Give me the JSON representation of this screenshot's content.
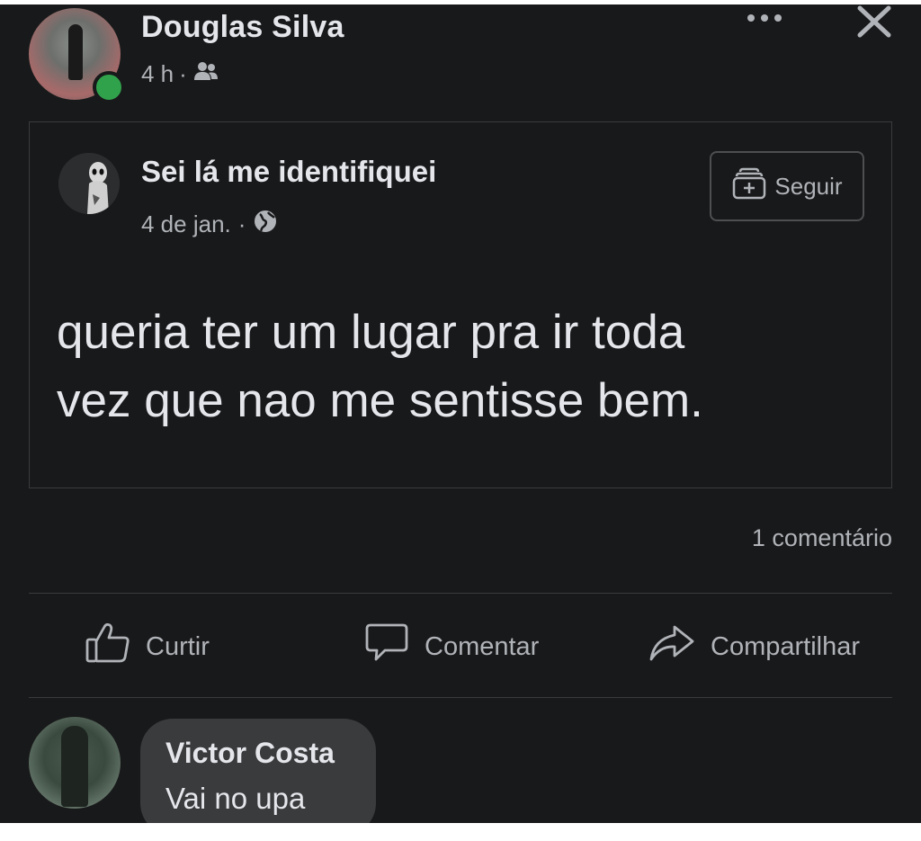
{
  "post": {
    "author": "Douglas Silva",
    "time": "4 h",
    "meta_separator": "·",
    "audience_icon": "friends-icon",
    "more_icon": "more-options-icon",
    "close_icon": "close-icon"
  },
  "shared": {
    "page_name": "Sei lá me identifiquei",
    "date": "4 de jan.",
    "meta_separator": "·",
    "privacy_icon": "globe-icon",
    "follow_label": "Seguir",
    "follow_icon": "add-page-icon",
    "text_line1": "queria ter um lugar pra ir toda",
    "text_line2": "vez que nao me sentisse bem."
  },
  "stats": {
    "comments": "1 comentário"
  },
  "actions": {
    "like": "Curtir",
    "comment": "Comentar",
    "share": "Compartilhar"
  },
  "comment": {
    "author": "Victor Costa",
    "text": "Vai no upa"
  },
  "colors": {
    "background": "#18191a",
    "text_primary": "#e4e6eb",
    "text_secondary": "#b0b3b8",
    "divider": "#3a3b3c",
    "bubble": "#3a3b3c",
    "online": "#31a24c"
  }
}
